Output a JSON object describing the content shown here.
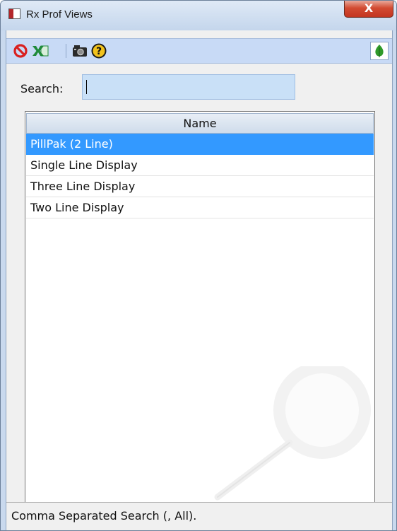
{
  "window": {
    "title": "Rx Prof Views",
    "close_label": "X"
  },
  "toolbar": {
    "buttons": [
      {
        "icon": "cancel-icon",
        "color": "#d92020"
      },
      {
        "icon": "excel-export-icon",
        "color": "#1f8a3a"
      },
      {
        "icon": "camera-icon",
        "color": "#222222"
      },
      {
        "icon": "help-icon",
        "color": "#f2c21b"
      }
    ],
    "right_icon": {
      "icon": "leaf-icon",
      "color": "#2f9a2a"
    }
  },
  "search": {
    "label": "Search:",
    "value": ""
  },
  "grid": {
    "columns": [
      "Name"
    ],
    "rows": [
      {
        "name": "PillPak (2 Line)",
        "selected": true
      },
      {
        "name": "Single Line Display",
        "selected": false
      },
      {
        "name": "Three Line Display",
        "selected": false
      },
      {
        "name": "Two Line Display",
        "selected": false
      }
    ],
    "selection_color": "#3399ff"
  },
  "status": {
    "text": "Comma Separated Search (, All)."
  }
}
